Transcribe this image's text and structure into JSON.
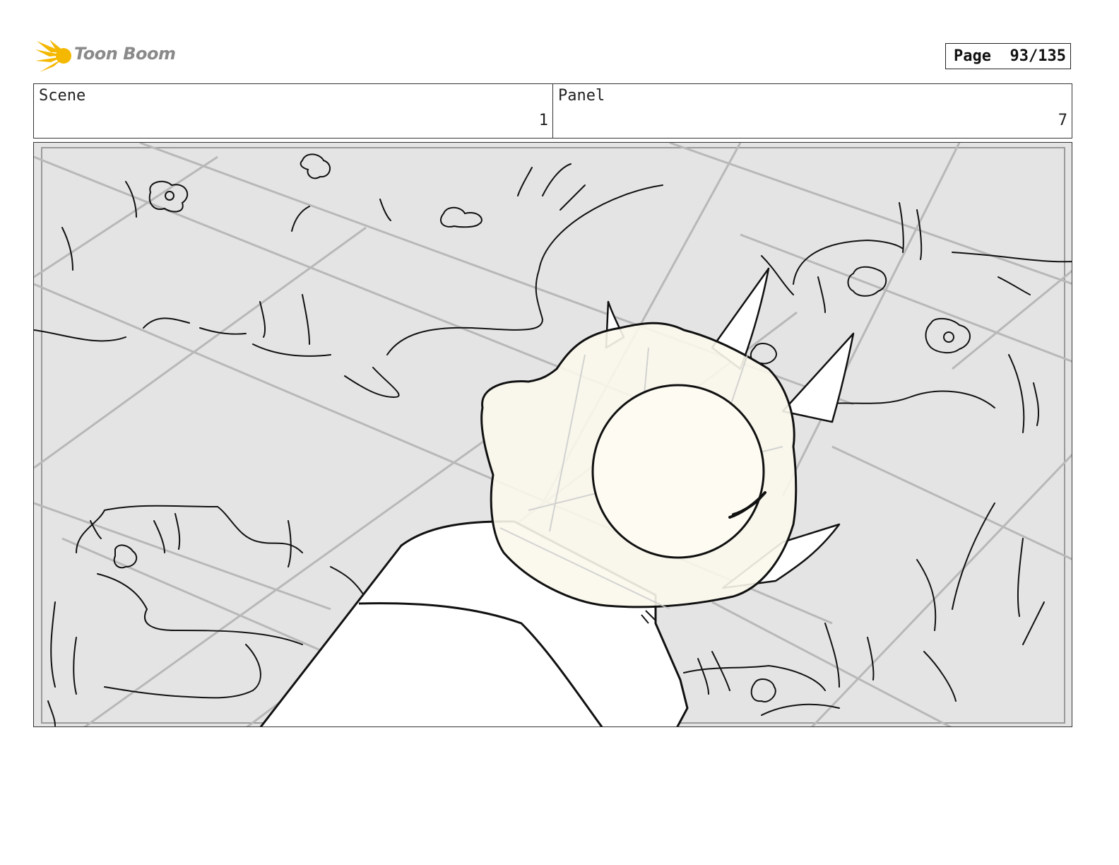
{
  "header": {
    "logo_text": "Toon Boom",
    "page_label": "Page",
    "page_value": "93/135"
  },
  "scene": {
    "label": "Scene",
    "value": "1"
  },
  "panel": {
    "label": "Panel",
    "value": "7"
  },
  "colors": {
    "logo_accent": "#f5b800",
    "ground": "#e4e4e4",
    "glow": "#fbf8ec",
    "line": "#111111",
    "grid": "#b8b8b8"
  }
}
